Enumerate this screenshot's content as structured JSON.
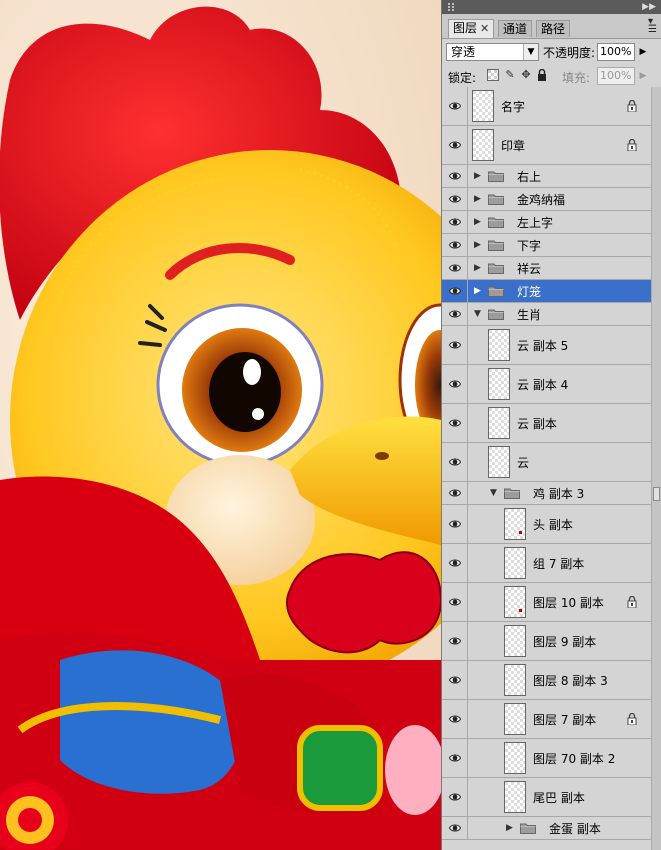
{
  "panel": {
    "tabs": [
      {
        "label": "图层",
        "active": true
      },
      {
        "label": "通道",
        "active": false
      },
      {
        "label": "路径",
        "active": false
      }
    ],
    "blend_mode": "穿透",
    "opacity_label": "不透明度:",
    "opacity_value": "100%",
    "lock_label": "锁定:",
    "fill_label": "填充:",
    "fill_value": "100%"
  },
  "layers": [
    {
      "name": "名字",
      "type": "layer",
      "indent": 0,
      "locked": true
    },
    {
      "name": "印章",
      "type": "layer",
      "indent": 0,
      "locked": true
    },
    {
      "name": "右上",
      "type": "group",
      "indent": 0,
      "expanded": false
    },
    {
      "name": "金鸡纳福",
      "type": "group",
      "indent": 0,
      "expanded": false
    },
    {
      "name": "左上字",
      "type": "group",
      "indent": 0,
      "expanded": false
    },
    {
      "name": "下字",
      "type": "group",
      "indent": 0,
      "expanded": false
    },
    {
      "name": "祥云",
      "type": "group",
      "indent": 0,
      "expanded": false
    },
    {
      "name": "灯笼",
      "type": "group",
      "indent": 0,
      "expanded": false,
      "selected": true
    },
    {
      "name": "生肖",
      "type": "group",
      "indent": 0,
      "expanded": true
    },
    {
      "name": "云 副本 5",
      "type": "layer",
      "indent": 1
    },
    {
      "name": "云 副本 4",
      "type": "layer",
      "indent": 1
    },
    {
      "name": "云 副本",
      "type": "layer",
      "indent": 1
    },
    {
      "name": "云",
      "type": "layer",
      "indent": 1
    },
    {
      "name": "鸡 副本 3",
      "type": "group",
      "indent": 1,
      "expanded": true
    },
    {
      "name": "头 副本",
      "type": "layer",
      "indent": 2,
      "mark": true
    },
    {
      "name": "组 7 副本",
      "type": "layer",
      "indent": 2
    },
    {
      "name": "图层 10 副本",
      "type": "layer",
      "indent": 2,
      "locked": true,
      "mark": true
    },
    {
      "name": "图层 9 副本",
      "type": "layer",
      "indent": 2
    },
    {
      "name": "图层 8 副本 3",
      "type": "layer",
      "indent": 2
    },
    {
      "name": "图层 7 副本",
      "type": "layer",
      "indent": 2,
      "locked": true
    },
    {
      "name": "图层 70 副本 2",
      "type": "layer",
      "indent": 2
    },
    {
      "name": "尾巴 副本",
      "type": "layer",
      "indent": 2
    },
    {
      "name": "金蛋 副本",
      "type": "group",
      "indent": 2,
      "expanded": false
    }
  ]
}
